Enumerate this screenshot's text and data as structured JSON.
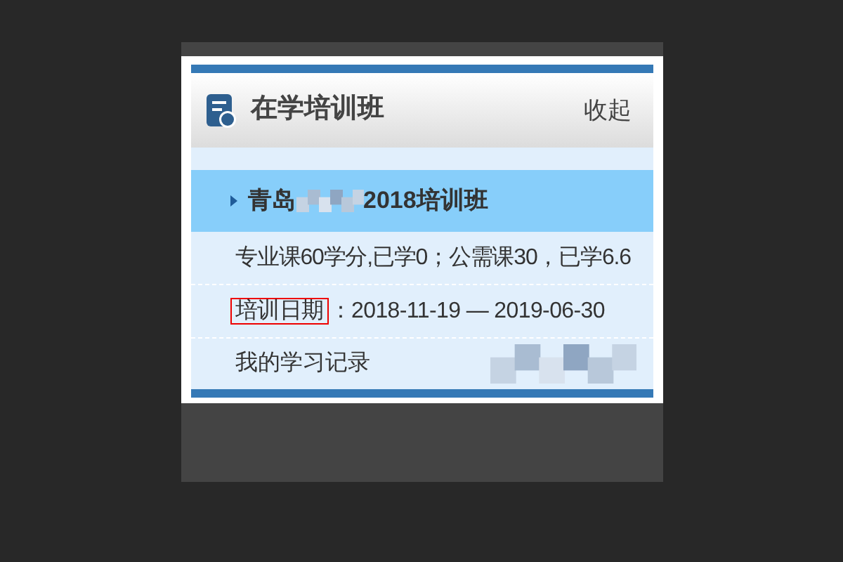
{
  "panel": {
    "title": "在学培训班",
    "collapse_link": "收起"
  },
  "course": {
    "title_start": "青岛",
    "title_end": "2018培训班",
    "selected": true
  },
  "credits": "专业课60学分,已学0；公需课30，已学6.6",
  "dates": {
    "label": "培训日期",
    "value": "：2018-11-19 — 2019-06-30"
  },
  "record_link": "我的学习记录"
}
